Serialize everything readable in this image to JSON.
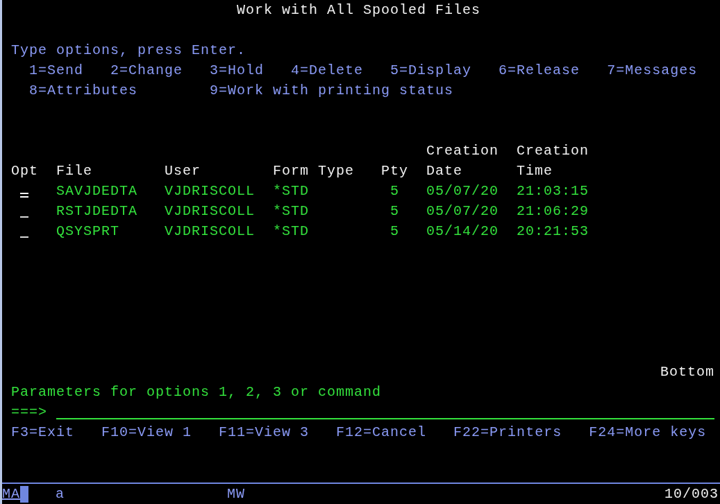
{
  "title": "Work with All Spooled Files",
  "instructions": "Type options, press Enter.",
  "options": [
    [
      "1=Send",
      "2=Change",
      "3=Hold",
      "4=Delete",
      "5=Display",
      "6=Release",
      "7=Messages"
    ],
    [
      "8=Attributes",
      "9=Work with printing status"
    ]
  ],
  "columns": [
    {
      "label": "Opt"
    },
    {
      "label": "File"
    },
    {
      "label": "User"
    },
    {
      "label": "Form Type"
    },
    {
      "label": "Pty"
    },
    {
      "top": "Creation",
      "label": "Date"
    },
    {
      "top": "Creation",
      "label": "Time"
    }
  ],
  "rows": [
    {
      "focused": true,
      "file": "SAVJDEDTA",
      "user": "VJDRISCOLL",
      "form_type": "*STD",
      "pty": "5",
      "date": "05/07/20",
      "time": "21:03:15"
    },
    {
      "focused": false,
      "file": "RSTJDEDTA",
      "user": "VJDRISCOLL",
      "form_type": "*STD",
      "pty": "5",
      "date": "05/07/20",
      "time": "21:06:29"
    },
    {
      "focused": false,
      "file": "QSYSPRT",
      "user": "VJDRISCOLL",
      "form_type": "*STD",
      "pty": "5",
      "date": "05/14/20",
      "time": "20:21:53"
    }
  ],
  "more": "Bottom",
  "parameters_label": "Parameters for options 1, 2, 3 or command",
  "prompt": "===>",
  "function_keys": [
    "F3=Exit",
    "F10=View 1",
    "F11=View 3",
    "F12=Cancel",
    "F22=Printers",
    "F24=More keys"
  ],
  "status_bar": {
    "mode": "MA",
    "field": "a",
    "state": "MW",
    "position": "10/003"
  }
}
